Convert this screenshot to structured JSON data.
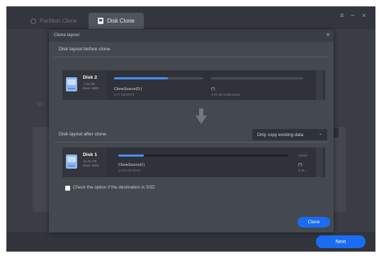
{
  "tabs": [
    {
      "label": "Partition Clone",
      "icon": "partition-clone-icon",
      "active": false
    },
    {
      "label": "Disk Clone",
      "icon": "disk-clone-icon",
      "active": true
    }
  ],
  "window_controls": {
    "menu": "≡",
    "minimize": "−",
    "close": "×"
  },
  "background": {
    "section_label": "SO"
  },
  "footer": {
    "next_label": "Next"
  },
  "modal": {
    "title": "Clone layout",
    "close": "×",
    "before": {
      "section_label": "Disk layout before clone",
      "disk": {
        "name": "Disk 2",
        "size": "7.68 GB",
        "type": "Basic MBR"
      },
      "partitions": [
        {
          "name": "CloneSource(D:)",
          "sub": "3.77 GB NTFS",
          "fill": 0.6
        },
        {
          "name": "(*)",
          "sub": "3.91 GB Unallocated",
          "fill": 0.0
        }
      ]
    },
    "after": {
      "section_label": "Disk layout after clone",
      "dropdown_value": "Only copy existing data",
      "dropdown_chevron": "⌄",
      "disk": {
        "name": "Disk 1",
        "size": "14.45 GB",
        "type": "Basic MBR"
      },
      "partitions": [
        {
          "name": "CloneSource(I:)",
          "sub": "14.45 GB NTFS",
          "fill": 0.15
        },
        {
          "name": "(*)",
          "sub": "8.38 ..."
        }
      ]
    },
    "ssd_option_label": "Check the option if the destination is SSD",
    "ssd_option_checked": false,
    "clone_label": "Clone"
  },
  "colors": {
    "accent": "#1a6df0",
    "bar": "#4a8ff5",
    "bg": "#3a3d45",
    "modal": "#44484f"
  }
}
